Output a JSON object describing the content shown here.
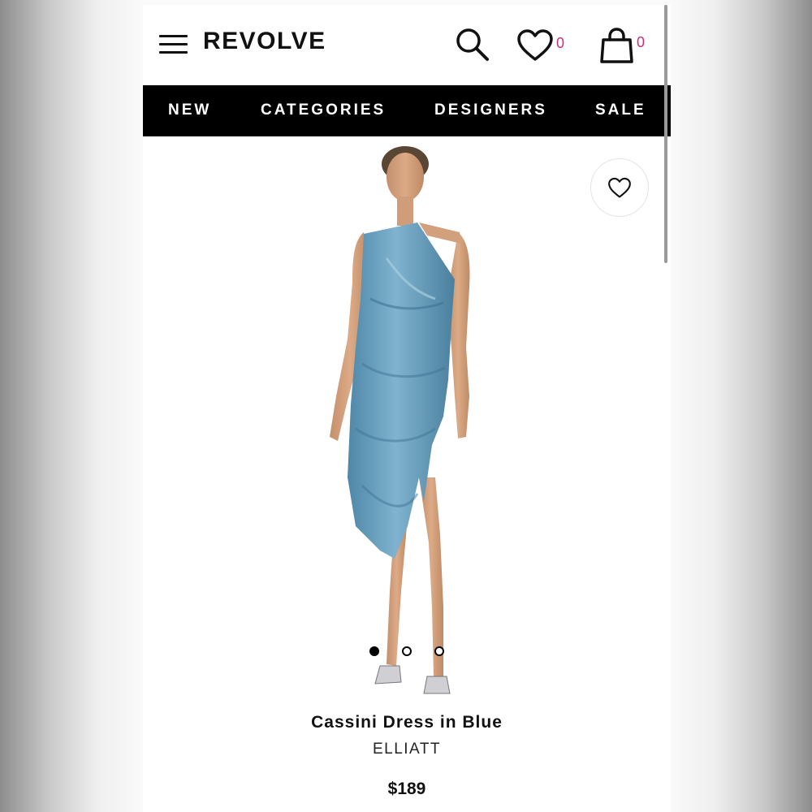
{
  "header": {
    "logo": "REVOLVE",
    "wishlist_count": "0",
    "bag_count": "0",
    "icons": [
      "menu-icon",
      "search-icon",
      "heart-icon",
      "bag-icon"
    ]
  },
  "nav": {
    "items": [
      "NEW",
      "CATEGORIES",
      "DESIGNERS",
      "SALE"
    ]
  },
  "product": {
    "name": "Cassini Dress in Blue",
    "brand": "ELLIATT",
    "price": "$189",
    "image_count": 3,
    "active_image": 1
  },
  "colors": {
    "badge": "#cc2d7a",
    "nav_background": "#000000",
    "dress": "#6aa0bd"
  }
}
